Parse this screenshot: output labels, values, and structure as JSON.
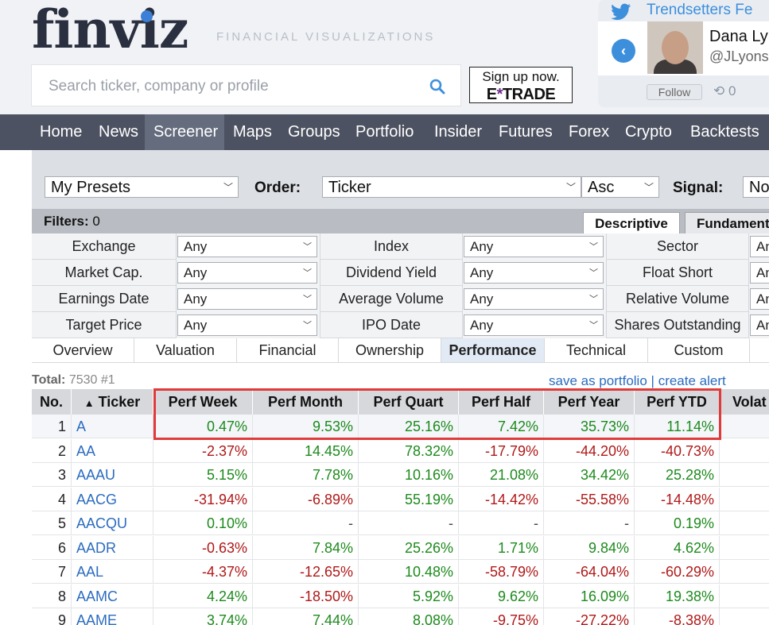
{
  "header": {
    "logo": "finviz",
    "tagline": "FINANCIAL VISUALIZATIONS",
    "search_placeholder": "Search ticker, company or profile",
    "ad_line1": "Sign up now.",
    "ad_brand_left": "E",
    "ad_brand_star": "*",
    "ad_brand_right": "TRADE"
  },
  "twitter": {
    "title": "Trendsetters Fe",
    "name": "Dana Ly",
    "handle": "@JLyons",
    "follow": "Follow",
    "retweets": "0"
  },
  "nav": [
    "Home",
    "News",
    "Screener",
    "Maps",
    "Groups",
    "Portfolio",
    "Insider",
    "Futures",
    "Forex",
    "Crypto",
    "Backtests"
  ],
  "controls": {
    "preset": "My Presets",
    "order_label": "Order:",
    "order_value": "Ticker",
    "direction": "Asc",
    "signal_label": "Signal:",
    "signal_value": "No"
  },
  "filters": {
    "label": "Filters:",
    "count": "0",
    "tabs": [
      "Descriptive",
      "Fundament"
    ],
    "rows": [
      [
        "Exchange",
        "Any",
        "Index",
        "Any",
        "Sector",
        "An"
      ],
      [
        "Market Cap.",
        "Any",
        "Dividend Yield",
        "Any",
        "Float Short",
        "An"
      ],
      [
        "Earnings Date",
        "Any",
        "Average Volume",
        "Any",
        "Relative Volume",
        "An"
      ],
      [
        "Target Price",
        "Any",
        "IPO Date",
        "Any",
        "Shares Outstanding",
        "An"
      ]
    ]
  },
  "views": [
    "Overview",
    "Valuation",
    "Financial",
    "Ownership",
    "Performance",
    "Technical",
    "Custom"
  ],
  "total": {
    "label": "Total:",
    "value": "7530 #1"
  },
  "links": {
    "save": "save as portfolio",
    "sep": "|",
    "alert": "create alert"
  },
  "table": {
    "columns": [
      "No.",
      "Ticker",
      "Perf Week",
      "Perf Month",
      "Perf Quart",
      "Perf Half",
      "Perf Year",
      "Perf YTD",
      "Volat"
    ],
    "sort_indicator": "▲",
    "rows": [
      [
        "1",
        "A",
        "0.47%",
        "9.53%",
        "25.16%",
        "7.42%",
        "35.73%",
        "11.14%"
      ],
      [
        "2",
        "AA",
        "-2.37%",
        "14.45%",
        "78.32%",
        "-17.79%",
        "-44.20%",
        "-40.73%"
      ],
      [
        "3",
        "AAAU",
        "5.15%",
        "7.78%",
        "10.16%",
        "21.08%",
        "34.42%",
        "25.28%"
      ],
      [
        "4",
        "AACG",
        "-31.94%",
        "-6.89%",
        "55.19%",
        "-14.42%",
        "-55.58%",
        "-14.48%"
      ],
      [
        "5",
        "AACQU",
        "0.10%",
        "-",
        "-",
        "-",
        "-",
        "0.19%"
      ],
      [
        "6",
        "AADR",
        "-0.63%",
        "7.84%",
        "25.26%",
        "1.71%",
        "9.84%",
        "4.62%"
      ],
      [
        "7",
        "AAL",
        "-4.37%",
        "-12.65%",
        "10.48%",
        "-58.79%",
        "-64.04%",
        "-60.29%"
      ],
      [
        "8",
        "AAMC",
        "4.24%",
        "-18.50%",
        "5.92%",
        "9.62%",
        "16.09%",
        "19.38%"
      ],
      [
        "9",
        "AAME",
        "3.74%",
        "7.44%",
        "8.08%",
        "-9.75%",
        "-27.22%",
        "-8.38%"
      ]
    ]
  },
  "colors": {
    "positive": "#1d8a1d",
    "negative": "#b01818",
    "link": "#2b6cc0",
    "highlight": "#e03a3a"
  }
}
